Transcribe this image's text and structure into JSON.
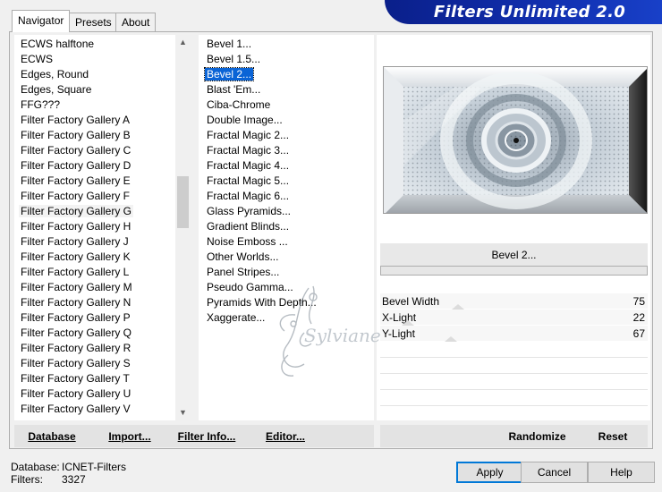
{
  "app_title": "Filters Unlimited 2.0",
  "tabs": [
    "Navigator",
    "Presets",
    "About"
  ],
  "categories": [
    "ECWS halftone",
    "ECWS",
    "Edges, Round",
    "Edges, Square",
    "FFG???",
    "Filter Factory Gallery A",
    "Filter Factory Gallery B",
    "Filter Factory Gallery C",
    "Filter Factory Gallery D",
    "Filter Factory Gallery E",
    "Filter Factory Gallery F",
    "Filter Factory Gallery G",
    "Filter Factory Gallery H",
    "Filter Factory Gallery J",
    "Filter Factory Gallery K",
    "Filter Factory Gallery L",
    "Filter Factory Gallery M",
    "Filter Factory Gallery N",
    "Filter Factory Gallery P",
    "Filter Factory Gallery Q",
    "Filter Factory Gallery R",
    "Filter Factory Gallery S",
    "Filter Factory Gallery T",
    "Filter Factory Gallery U",
    "Filter Factory Gallery V"
  ],
  "hovered_category": "Filter Factory Gallery G",
  "filters": [
    "Bevel 1...",
    "Bevel 1.5...",
    "Bevel 2...",
    "Blast 'Em...",
    "Ciba-Chrome",
    "Double Image...",
    "Fractal Magic 2...",
    "Fractal Magic 3...",
    "Fractal Magic 4...",
    "Fractal Magic 5...",
    "Fractal Magic 6...",
    "Glass Pyramids...",
    "Gradient Blinds...",
    "Noise Emboss ...",
    "Other Worlds...",
    "Panel Stripes...",
    "Pseudo Gamma...",
    "Pyramids With Depth...",
    "Xaggerate..."
  ],
  "selected_filter": "Bevel 2...",
  "filter_title": "Bevel 2...",
  "params": [
    {
      "label": "Bevel Width",
      "value": "75"
    },
    {
      "label": "X-Light",
      "value": "22"
    },
    {
      "label": "Y-Light",
      "value": "67"
    }
  ],
  "panel_buttons": {
    "database": "Database",
    "import": "Import...",
    "filter_info": "Filter Info...",
    "editor": "Editor...",
    "randomize": "Randomize",
    "reset": "Reset"
  },
  "footer": {
    "database_label": "Database:",
    "database_value": "ICNET-Filters",
    "filters_label": "Filters:",
    "filters_value": "3327"
  },
  "dialog_buttons": {
    "apply": "Apply",
    "cancel": "Cancel",
    "help": "Help"
  },
  "watermark": "Sylviane",
  "icons": [
    "scroll-up-icon",
    "scroll-down-icon"
  ],
  "colors": {
    "banner": "#1230b0",
    "selection": "#0a64d6",
    "default_button_border": "#0078d7"
  }
}
